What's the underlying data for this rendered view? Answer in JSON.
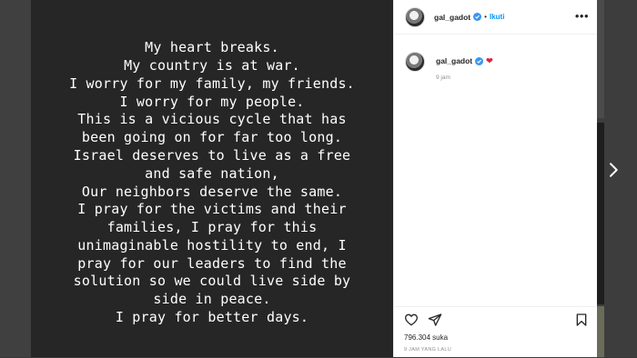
{
  "post": {
    "story_lines": [
      "My heart breaks.",
      "My country is at war.",
      "I worry for my family, my friends.",
      "I worry for my people.",
      "This is a vicious cycle that has",
      "been going on for far too long.",
      "Israel deserves to live as a free",
      "and safe nation,",
      "Our neighbors deserve the same.",
      "I pray for the victims and their",
      "families, I pray for this",
      "unimaginable hostility to end, I",
      "pray for our leaders to find the",
      "solution so we could live side by",
      "side in peace.",
      "I pray for better days."
    ]
  },
  "header": {
    "username": "gal_gadot",
    "separator": "•",
    "follow_label": "Ikuti",
    "more_icon": "ellipsis-icon"
  },
  "comment": {
    "username": "gal_gadot",
    "emoji": "red-heart-icon",
    "time": "9 jam"
  },
  "actions": {
    "like_icon": "heart-outline-icon",
    "share_icon": "share-icon",
    "save_icon": "bookmark-icon",
    "likes_text": "796.304 suka",
    "date_text": "9 JAM YANG LALU"
  },
  "colors": {
    "follow": "#0095f6",
    "verified": "#3897f0",
    "heart": "#d7263d",
    "media_bg": "#262626"
  }
}
